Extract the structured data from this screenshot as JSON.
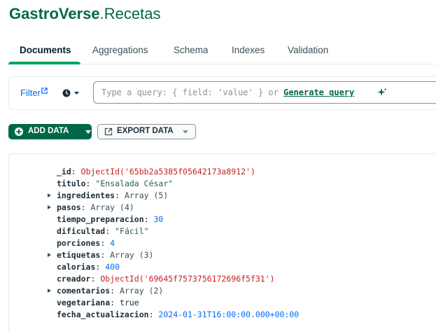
{
  "header": {
    "db_name": "GastroVerse",
    "separator": ".",
    "collection_name": "Recetas"
  },
  "tabs": [
    {
      "label": "Documents",
      "active": true
    },
    {
      "label": "Aggregations",
      "active": false
    },
    {
      "label": "Schema",
      "active": false
    },
    {
      "label": "Indexes",
      "active": false
    },
    {
      "label": "Validation",
      "active": false
    }
  ],
  "filter": {
    "label": "Filter",
    "placeholder": "Type a query: { field: 'value' } or ",
    "generate_label": "Generate query"
  },
  "toolbar": {
    "add_data_label": "ADD DATA",
    "export_label": "EXPORT DATA"
  },
  "document": {
    "fields": [
      {
        "key": "_id",
        "value": "ObjectId('65bb2a5385f05642173a8912')",
        "kind": "oid",
        "expandable": false
      },
      {
        "key": "titulo",
        "value": "\"Ensalada César\"",
        "kind": "str",
        "expandable": false
      },
      {
        "key": "ingredientes",
        "value": "Array (5)",
        "kind": "type",
        "expandable": true
      },
      {
        "key": "pasos",
        "value": "Array (4)",
        "kind": "type",
        "expandable": true
      },
      {
        "key": "tiempo_preparacion",
        "value": "30",
        "kind": "num",
        "expandable": false
      },
      {
        "key": "dificultad",
        "value": "\"Fácil\"",
        "kind": "str",
        "expandable": false
      },
      {
        "key": "porciones",
        "value": "4",
        "kind": "num",
        "expandable": false
      },
      {
        "key": "etiquetas",
        "value": "Array (3)",
        "kind": "type",
        "expandable": true
      },
      {
        "key": "calorias",
        "value": "400",
        "kind": "num",
        "expandable": false
      },
      {
        "key": "creador",
        "value": "ObjectId('69645f7573756172696f5f31')",
        "kind": "oid",
        "expandable": false
      },
      {
        "key": "comentarios",
        "value": "Array (2)",
        "kind": "type",
        "expandable": true
      },
      {
        "key": "vegetariana",
        "value": "true",
        "kind": "bool",
        "expandable": false
      },
      {
        "key": "fecha_actualizacion",
        "value": "2024-01-31T16:00:00.000+00:00",
        "kind": "date",
        "expandable": false
      }
    ]
  },
  "colors": {
    "brand_green": "#00684a",
    "tab_underline": "#00a35c",
    "link_blue": "#016bf8",
    "objectid_red": "#c5221f"
  },
  "icons": [
    "external-link-icon",
    "clock-icon",
    "sparkle-icon",
    "plus-circle-icon",
    "export-icon",
    "expand-arrow-icon"
  ]
}
